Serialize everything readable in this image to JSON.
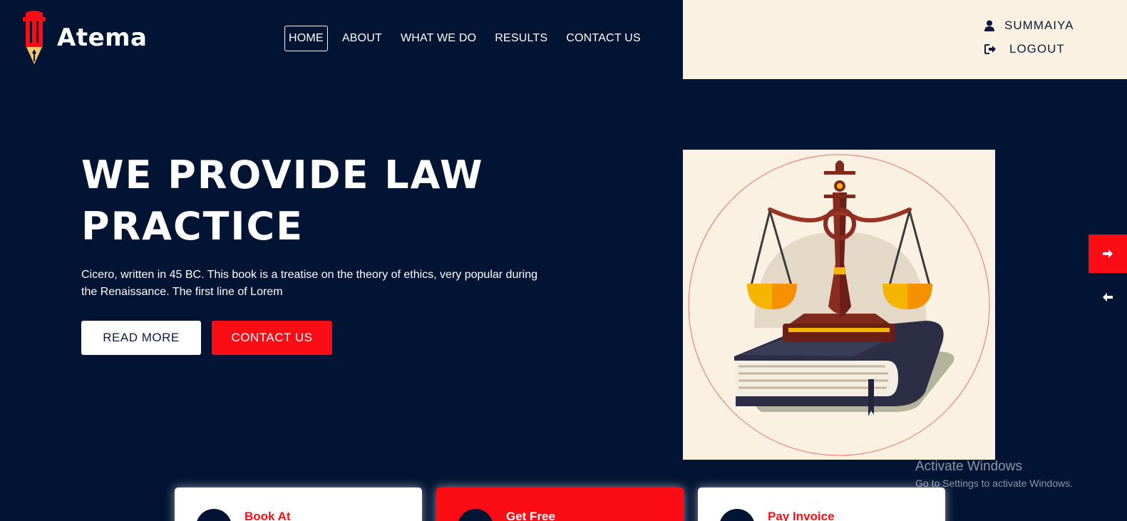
{
  "brand": {
    "name": "Atema",
    "logo_icon": "pen-column-logo"
  },
  "nav": {
    "items": [
      {
        "label": "HOME",
        "active": true
      },
      {
        "label": "ABOUT"
      },
      {
        "label": "WHAT WE DO"
      },
      {
        "label": "RESULTS"
      },
      {
        "label": "CONTACT US"
      }
    ]
  },
  "user": {
    "name": "SUMMAIYA",
    "logout_label": "LOGOUT",
    "user_icon": "user-icon",
    "logout_icon": "sign-out-icon"
  },
  "hero": {
    "title_line1": "WE PROVIDE LAW",
    "title_line2": "PRACTICE",
    "description": "Cicero, written in 45 BC. This book is a treatise on the theory of ethics, very popular during the Renaissance. The first line of Lorem",
    "read_more_label": "READ MORE",
    "contact_label": "CONTACT US",
    "image": "scales-of-justice-on-book"
  },
  "slider": {
    "next_icon": "arrow-right-icon",
    "prev_icon": "arrow-left-icon"
  },
  "cards": [
    {
      "title": "Book At"
    },
    {
      "title": "Get Free"
    },
    {
      "title": "Pay Invoice"
    }
  ],
  "watermark": {
    "title": "Activate Windows",
    "subtitle": "Go to Settings to activate Windows."
  },
  "colors": {
    "navy": "#021434",
    "cream": "#faf1e2",
    "red": "#fc0d15"
  }
}
